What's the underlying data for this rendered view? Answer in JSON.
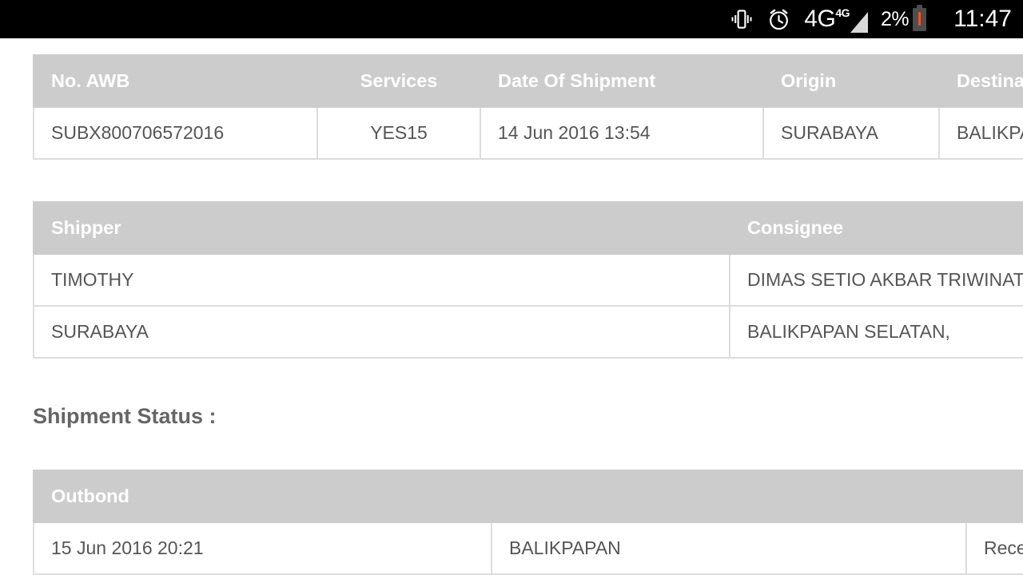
{
  "statusbar": {
    "vibrate_icon": "vibrate-icon",
    "alarm_icon": "alarm-clock-icon",
    "network_label": "4G",
    "network_sup": "4G",
    "signal_icon": "signal-bars-icon",
    "battery_percent": "2%",
    "battery_icon": "battery-low-icon",
    "time": "11:47",
    "bg_color": "#000000",
    "text_color": "#ffffff",
    "battery_warning_color": "#f4511e"
  },
  "colors": {
    "header_bg": "#cccccc",
    "header_text": "#ffffff",
    "cell_text": "#555555",
    "cell_border": "#dddddd",
    "page_bg": "#ffffff",
    "title_text": "#666666"
  },
  "summary_table": {
    "name": "shipment-summary-table",
    "headers": [
      "No. AWB",
      "Services",
      "Date Of Shipment",
      "Origin",
      "Destination"
    ],
    "rows": [
      [
        "SUBX800706572016",
        "YES15",
        "14 Jun 2016 13:54",
        "SURABAYA",
        "BALIKPAPAN"
      ]
    ]
  },
  "parties_table": {
    "name": "shipper-consignee-table",
    "headers": [
      "Shipper",
      "Consignee"
    ],
    "rows": [
      [
        "TIMOTHY",
        "DIMAS SETIO AKBAR TRIWINATA"
      ],
      [
        "SURABAYA",
        "BALIKPAPAN SELATAN,"
      ]
    ]
  },
  "section": {
    "shipment_status_title": "Shipment Status :"
  },
  "outbond_table": {
    "name": "outbond-status-table",
    "headers": [
      "Outbond",
      "",
      ""
    ],
    "rows": [
      [
        "15 Jun 2016 20:21",
        "BALIKPAPAN",
        "Received"
      ]
    ]
  }
}
